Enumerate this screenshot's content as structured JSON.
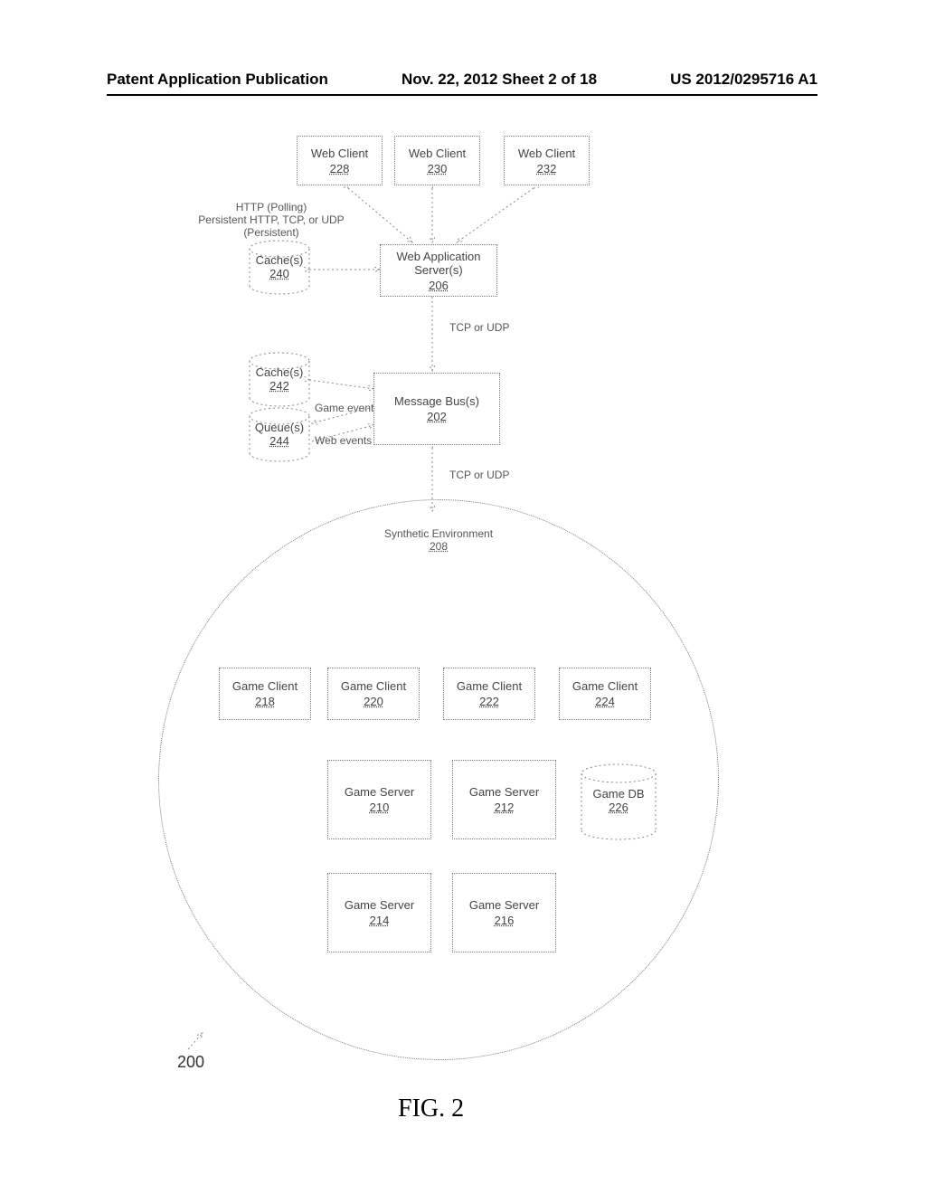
{
  "header": {
    "left": "Patent Application Publication",
    "center": "Nov. 22, 2012  Sheet 2 of 18",
    "right": "US 2012/0295716 A1"
  },
  "figure": {
    "caption": "FIG. 2",
    "ref_pointer": "200"
  },
  "labels": {
    "http_polling": "HTTP (Polling)",
    "persistent": "Persistent HTTP, TCP, or UDP (Persistent)",
    "tcp_udp_1": "TCP or UDP",
    "tcp_udp_2": "TCP or UDP",
    "game_events": "Game events",
    "web_events": "Web events",
    "synthetic_env": "Synthetic Environment",
    "synthetic_env_ref": "208"
  },
  "nodes": {
    "web_client_1": {
      "label": "Web Client",
      "ref": "228"
    },
    "web_client_2": {
      "label": "Web Client",
      "ref": "230"
    },
    "web_client_3": {
      "label": "Web Client",
      "ref": "232"
    },
    "web_app_server": {
      "label": "Web Application\nServer(s)",
      "ref": "206"
    },
    "cache_1": {
      "label": "Cache(s)",
      "ref": "240"
    },
    "cache_2": {
      "label": "Cache(s)",
      "ref": "242"
    },
    "queue": {
      "label": "Queue(s)",
      "ref": "244"
    },
    "message_bus": {
      "label": "Message Bus(s)",
      "ref": "202"
    },
    "game_client_1": {
      "label": "Game Client",
      "ref": "218"
    },
    "game_client_2": {
      "label": "Game Client",
      "ref": "220"
    },
    "game_client_3": {
      "label": "Game Client",
      "ref": "222"
    },
    "game_client_4": {
      "label": "Game Client",
      "ref": "224"
    },
    "game_server_1": {
      "label": "Game Server",
      "ref": "210"
    },
    "game_server_2": {
      "label": "Game Server",
      "ref": "212"
    },
    "game_server_3": {
      "label": "Game Server",
      "ref": "214"
    },
    "game_server_4": {
      "label": "Game Server",
      "ref": "216"
    },
    "game_db": {
      "label": "Game DB",
      "ref": "226"
    }
  }
}
